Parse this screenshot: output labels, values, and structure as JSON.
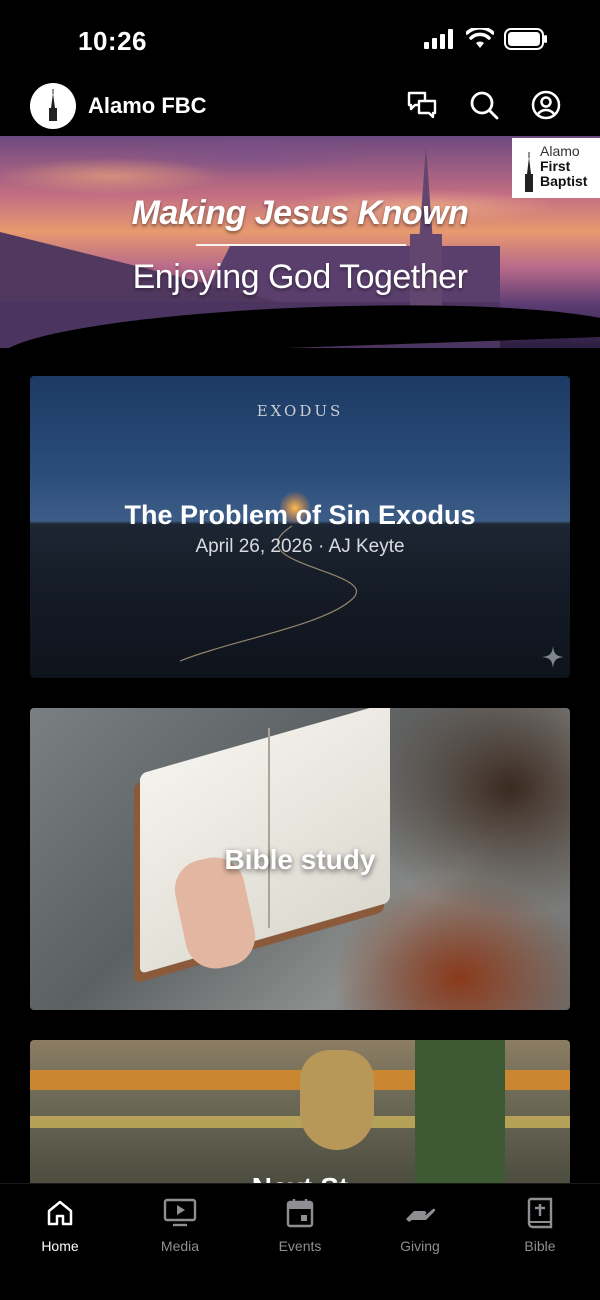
{
  "status_bar": {
    "time": "10:26"
  },
  "header": {
    "app_title": "Alamo FBC"
  },
  "hero": {
    "title": "Making Jesus Known",
    "subtitle": "Enjoying God Together",
    "corner_logo": {
      "line1": "Alamo",
      "line2": "First",
      "line3": "Baptist"
    }
  },
  "cards": [
    {
      "kicker": "EXODUS",
      "title": "The Problem of Sin Exodus",
      "meta": "April 26, 2026 · AJ Keyte"
    },
    {
      "title": "Bible study"
    },
    {
      "title": "Next St"
    }
  ],
  "tabs": [
    {
      "label": "Home",
      "icon": "home-icon",
      "active": true
    },
    {
      "label": "Media",
      "icon": "media-icon",
      "active": false
    },
    {
      "label": "Events",
      "icon": "calendar-icon",
      "active": false
    },
    {
      "label": "Giving",
      "icon": "giving-icon",
      "active": false
    },
    {
      "label": "Bible",
      "icon": "bible-icon",
      "active": false
    }
  ],
  "colors": {
    "background": "#000000",
    "tab_inactive": "#8e8e93",
    "tab_active": "#ffffff"
  }
}
